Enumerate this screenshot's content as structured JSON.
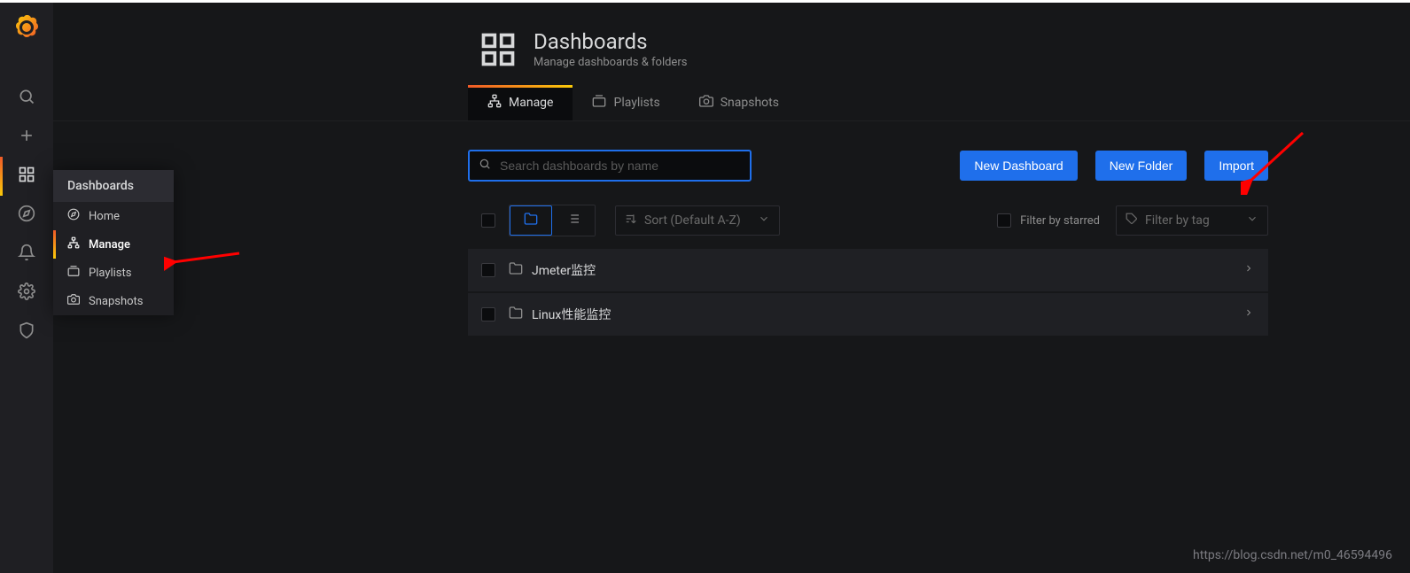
{
  "sidebar": {
    "flyout": {
      "title": "Dashboards",
      "items": [
        {
          "icon": "compass-icon",
          "label": "Home"
        },
        {
          "icon": "sitemap-icon",
          "label": "Manage",
          "active": true
        },
        {
          "icon": "playlist-icon",
          "label": "Playlists"
        },
        {
          "icon": "camera-icon",
          "label": "Snapshots"
        }
      ]
    }
  },
  "page": {
    "title": "Dashboards",
    "subtitle": "Manage dashboards & folders"
  },
  "tabs": [
    {
      "icon": "sitemap-icon",
      "label": "Manage",
      "active": true
    },
    {
      "icon": "playlist-icon",
      "label": "Playlists"
    },
    {
      "icon": "camera-icon",
      "label": "Snapshots"
    }
  ],
  "toolbar": {
    "search_placeholder": "Search dashboards by name",
    "btn_new_dashboard": "New Dashboard",
    "btn_new_folder": "New Folder",
    "btn_import": "Import"
  },
  "filters": {
    "sort_label": "Sort (Default A-Z)",
    "starred_label": "Filter by starred",
    "tag_label": "Filter by tag"
  },
  "list": [
    {
      "name": "Jmeter监控"
    },
    {
      "name": "Linux性能监控"
    }
  ],
  "watermark": "https://blog.csdn.net/m0_46594496"
}
